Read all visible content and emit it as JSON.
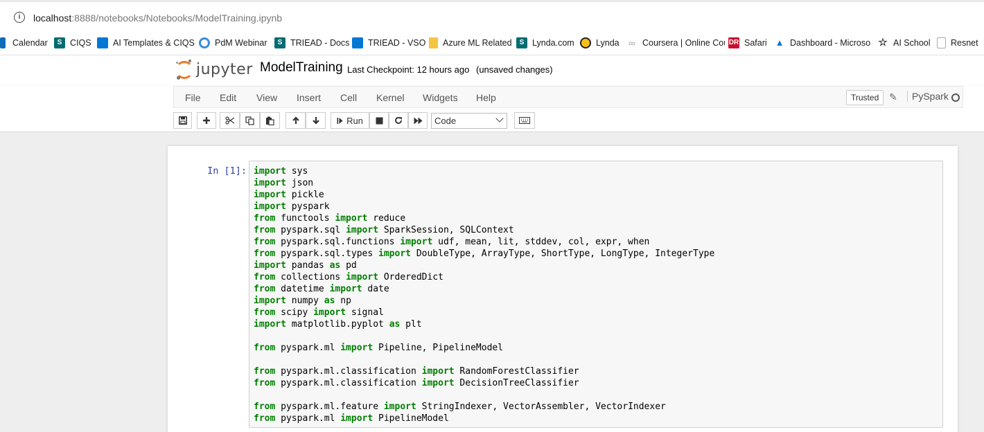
{
  "browser": {
    "url_host": "localhost",
    "url_path": ":8888/notebooks/Notebooks/ModelTraining.ipynb"
  },
  "bookmarks": [
    {
      "label": "Calendar",
      "icon": "calendar-icon",
      "color": "#0f6cbd"
    },
    {
      "label": "CIQS",
      "icon": "sharepoint-icon",
      "color": "#036c70"
    },
    {
      "label": "AI Templates & CIQS",
      "icon": "vso-icon",
      "color": "#0078d4"
    },
    {
      "label": "PdM Webinar",
      "icon": "webinar-icon",
      "color": "#3a8dde"
    },
    {
      "label": "TRIEAD - Docs",
      "icon": "sharepoint-icon",
      "color": "#036c70"
    },
    {
      "label": "TRIEAD - VSO",
      "icon": "vso-icon",
      "color": "#0078d4"
    },
    {
      "label": "Azure ML Related",
      "icon": "folder-icon",
      "color": "#f5c542"
    },
    {
      "label": "Lynda.com",
      "icon": "sharepoint-icon",
      "color": "#036c70"
    },
    {
      "label": "Lynda",
      "icon": "lynda-icon",
      "color": "#222222"
    },
    {
      "label": "Coursera | Online Cou",
      "icon": "coursera-icon",
      "color": "#cccccc"
    },
    {
      "label": "Safari",
      "icon": "safari-icon",
      "color": "#c8102e"
    },
    {
      "label": "Dashboard - Microso",
      "icon": "azure-icon",
      "color": "#0078d4"
    },
    {
      "label": "AI School",
      "icon": "star-icon",
      "color": "#333333"
    },
    {
      "label": "Resnet",
      "icon": "doc-icon",
      "color": "#999999"
    }
  ],
  "jupyter": {
    "logo_text": "jupyter",
    "notebook_name": "ModelTraining",
    "checkpoint_label": "Last Checkpoint:",
    "checkpoint_time": "12 hours ago",
    "unsaved": "(unsaved changes)"
  },
  "menu": [
    "File",
    "Edit",
    "View",
    "Insert",
    "Cell",
    "Kernel",
    "Widgets",
    "Help"
  ],
  "trusted_label": "Trusted",
  "kernel_name": "PySpark",
  "toolbar": {
    "run_label": "Run",
    "cell_type": "Code"
  },
  "cell": {
    "prompt": "In [1]:",
    "lines": [
      [
        [
          "kw",
          "import"
        ],
        [
          "t",
          " sys"
        ]
      ],
      [
        [
          "kw",
          "import"
        ],
        [
          "t",
          " json"
        ]
      ],
      [
        [
          "kw",
          "import"
        ],
        [
          "t",
          " pickle"
        ]
      ],
      [
        [
          "kw",
          "import"
        ],
        [
          "t",
          " pyspark"
        ]
      ],
      [
        [
          "kw",
          "from"
        ],
        [
          "t",
          " functools "
        ],
        [
          "kw",
          "import"
        ],
        [
          "t",
          " reduce"
        ]
      ],
      [
        [
          "kw",
          "from"
        ],
        [
          "t",
          " pyspark.sql "
        ],
        [
          "kw",
          "import"
        ],
        [
          "t",
          " SparkSession, SQLContext"
        ]
      ],
      [
        [
          "kw",
          "from"
        ],
        [
          "t",
          " pyspark.sql.functions "
        ],
        [
          "kw",
          "import"
        ],
        [
          "t",
          " udf, mean, lit, stddev, col, expr, when"
        ]
      ],
      [
        [
          "kw",
          "from"
        ],
        [
          "t",
          " pyspark.sql.types "
        ],
        [
          "kw",
          "import"
        ],
        [
          "t",
          " DoubleType, ArrayType, ShortType, LongType, IntegerType"
        ]
      ],
      [
        [
          "kw",
          "import"
        ],
        [
          "t",
          " pandas "
        ],
        [
          "kw",
          "as"
        ],
        [
          "t",
          " pd"
        ]
      ],
      [
        [
          "kw",
          "from"
        ],
        [
          "t",
          " collections "
        ],
        [
          "kw",
          "import"
        ],
        [
          "t",
          " OrderedDict"
        ]
      ],
      [
        [
          "kw",
          "from"
        ],
        [
          "t",
          " datetime "
        ],
        [
          "kw",
          "import"
        ],
        [
          "t",
          " date"
        ]
      ],
      [
        [
          "kw",
          "import"
        ],
        [
          "t",
          " numpy "
        ],
        [
          "kw",
          "as"
        ],
        [
          "t",
          " np"
        ]
      ],
      [
        [
          "kw",
          "from"
        ],
        [
          "t",
          " scipy "
        ],
        [
          "kw",
          "import"
        ],
        [
          "t",
          " signal"
        ]
      ],
      [
        [
          "kw",
          "import"
        ],
        [
          "t",
          " matplotlib.pyplot "
        ],
        [
          "kw",
          "as"
        ],
        [
          "t",
          " plt"
        ]
      ],
      [],
      [
        [
          "kw",
          "from"
        ],
        [
          "t",
          " pyspark.ml "
        ],
        [
          "kw",
          "import"
        ],
        [
          "t",
          " Pipeline, PipelineModel"
        ]
      ],
      [],
      [
        [
          "kw",
          "from"
        ],
        [
          "t",
          " pyspark.ml.classification "
        ],
        [
          "kw",
          "import"
        ],
        [
          "t",
          " RandomForestClassifier"
        ]
      ],
      [
        [
          "kw",
          "from"
        ],
        [
          "t",
          " pyspark.ml.classification "
        ],
        [
          "kw",
          "import"
        ],
        [
          "t",
          " DecisionTreeClassifier"
        ]
      ],
      [],
      [
        [
          "kw",
          "from"
        ],
        [
          "t",
          " pyspark.ml.feature "
        ],
        [
          "kw",
          "import"
        ],
        [
          "t",
          " StringIndexer, VectorAssembler, VectorIndexer"
        ]
      ],
      [
        [
          "kw",
          "from"
        ],
        [
          "t",
          " pyspark.ml "
        ],
        [
          "kw",
          "import"
        ],
        [
          "t",
          " PipelineModel"
        ]
      ]
    ]
  }
}
